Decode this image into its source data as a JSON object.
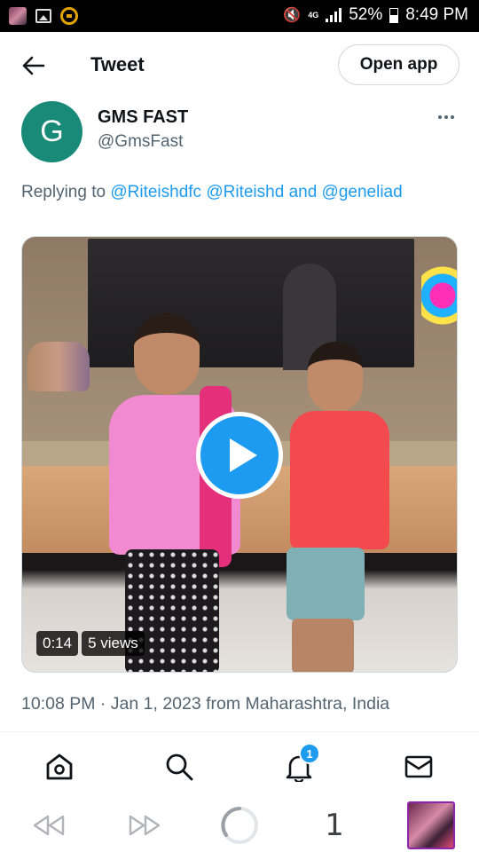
{
  "status_bar": {
    "network": "4G",
    "battery": "52%",
    "time": "8:49 PM"
  },
  "header": {
    "title": "Tweet",
    "open_app_label": "Open app"
  },
  "author": {
    "avatar_letter": "G",
    "avatar_color": "#1a8a78",
    "name": "GMS FAST",
    "handle": "@GmsFast"
  },
  "reply": {
    "prefix": "Replying to",
    "mention1": "@Riteishdfc",
    "mention2": "@Riteishd",
    "and": "and",
    "mention3": "@geneliad"
  },
  "video": {
    "duration": "0:14",
    "views": "5 views"
  },
  "timestamp": "10:08 PM · Jan 1, 2023 from Maharashtra, India",
  "bottom_nav": {
    "items": [
      "home-icon",
      "search-icon",
      "bell-icon",
      "mail-icon"
    ],
    "notification_count": "1"
  },
  "browser_bar": {
    "tab_count": "1"
  },
  "colors": {
    "accent": "#1d9bf0",
    "secondary_text": "#536471"
  }
}
